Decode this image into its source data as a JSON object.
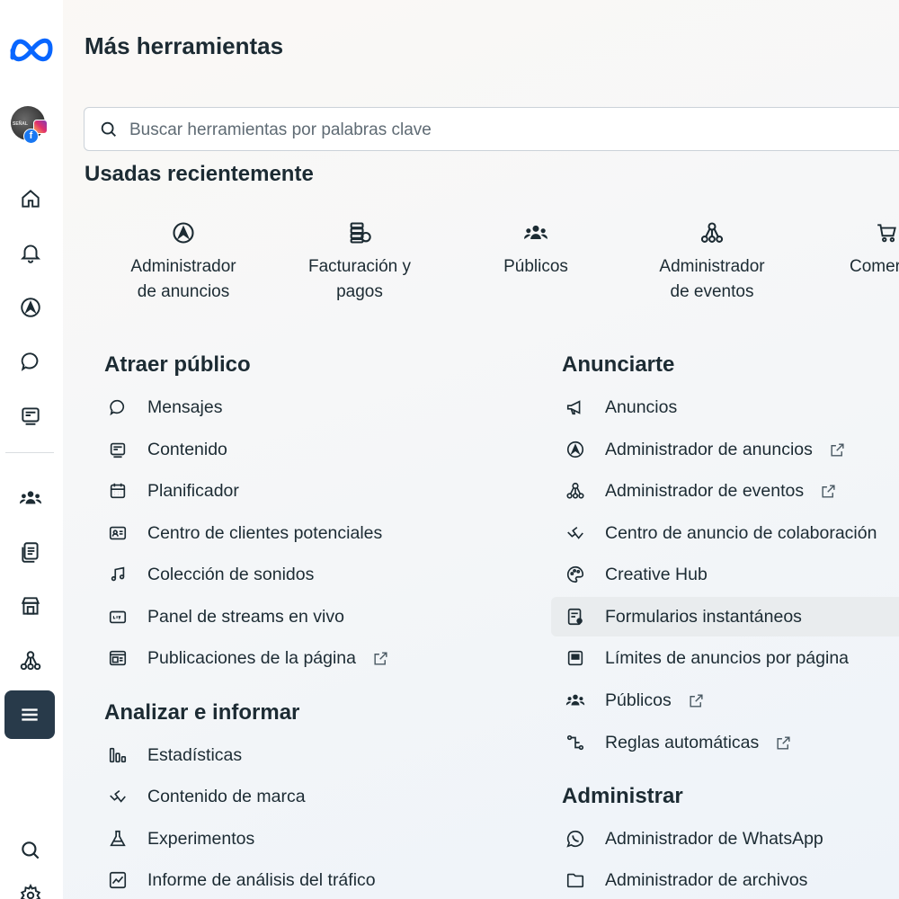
{
  "page_title": "Más herramientas",
  "search": {
    "placeholder": "Buscar herramientas por palabras clave",
    "icon": "search-icon"
  },
  "sidebar": {
    "avatar_text": "SEÑAL",
    "fb_badge": "f",
    "items": [
      {
        "name": "home",
        "icon": "home-icon"
      },
      {
        "name": "notifications",
        "icon": "bell-icon"
      },
      {
        "name": "ads-manager",
        "icon": "ads-manager-icon"
      },
      {
        "name": "messages",
        "icon": "chat-icon"
      },
      {
        "name": "content",
        "icon": "content-icon"
      },
      {
        "name": "audiences",
        "icon": "people-icon"
      },
      {
        "name": "pages",
        "icon": "documents-icon"
      },
      {
        "name": "commerce",
        "icon": "store-icon"
      },
      {
        "name": "events",
        "icon": "events-icon"
      },
      {
        "name": "all-tools",
        "icon": "menu-icon",
        "active": true
      },
      {
        "name": "search",
        "icon": "search-icon"
      },
      {
        "name": "settings",
        "icon": "gear-icon"
      }
    ]
  },
  "recent": {
    "title": "Usadas recientemente",
    "items": [
      {
        "line1": "Administrador",
        "line2": "de anuncios",
        "icon": "ads-manager-icon"
      },
      {
        "line1": "Facturación y",
        "line2": "pagos",
        "icon": "billing-icon"
      },
      {
        "line1": "Públicos",
        "line2": "",
        "icon": "people-icon"
      },
      {
        "line1": "Administrador",
        "line2": "de eventos",
        "icon": "events-icon"
      },
      {
        "line1": "Comer",
        "line2": "",
        "icon": "cart-icon"
      }
    ]
  },
  "groups": {
    "attract": {
      "title": "Atraer público",
      "items": [
        {
          "label": "Mensajes",
          "icon": "chat-icon",
          "external": false
        },
        {
          "label": "Contenido",
          "icon": "content-icon",
          "external": false
        },
        {
          "label": "Planificador",
          "icon": "calendar-icon",
          "external": false
        },
        {
          "label": "Centro de clientes potenciales",
          "icon": "contact-card-icon",
          "external": false
        },
        {
          "label": "Colección de sonidos",
          "icon": "music-note-icon",
          "external": false
        },
        {
          "label": "Panel de streams en vivo",
          "icon": "live-icon",
          "external": false
        },
        {
          "label": "Publicaciones de la página",
          "icon": "page-posts-icon",
          "external": true
        }
      ]
    },
    "analyze": {
      "title": "Analizar e informar",
      "items": [
        {
          "label": "Estadísticas",
          "icon": "bar-chart-icon",
          "external": false
        },
        {
          "label": "Contenido de marca",
          "icon": "handshake-icon",
          "external": false
        },
        {
          "label": "Experimentos",
          "icon": "flask-icon",
          "external": false
        },
        {
          "label": "Informe de análisis del tráfico",
          "icon": "line-chart-icon",
          "external": false
        }
      ]
    },
    "advertise": {
      "title": "Anunciarte",
      "items": [
        {
          "label": "Anuncios",
          "icon": "megaphone-icon",
          "external": false
        },
        {
          "label": "Administrador de anuncios",
          "icon": "ads-manager-icon",
          "external": true
        },
        {
          "label": "Administrador de eventos",
          "icon": "events-icon",
          "external": true
        },
        {
          "label": "Centro de anuncio de colaboración",
          "icon": "handshake-icon",
          "external": false
        },
        {
          "label": "Creative Hub",
          "icon": "palette-icon",
          "external": false
        },
        {
          "label": "Formularios instantáneos",
          "icon": "form-icon",
          "external": false,
          "highlighted": true
        },
        {
          "label": "Límites de anuncios por página",
          "icon": "limits-icon",
          "external": false
        },
        {
          "label": "Públicos",
          "icon": "people-icon",
          "external": true
        },
        {
          "label": "Reglas automáticas",
          "icon": "rules-icon",
          "external": true
        }
      ]
    },
    "manage": {
      "title": "Administrar",
      "items": [
        {
          "label": "Administrador de WhatsApp",
          "icon": "whatsapp-icon",
          "external": false
        },
        {
          "label": "Administrador de archivos",
          "icon": "folder-icon",
          "external": false
        }
      ]
    }
  }
}
